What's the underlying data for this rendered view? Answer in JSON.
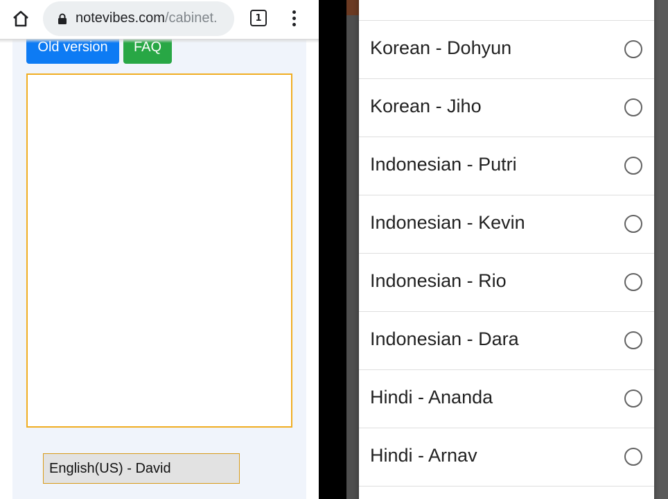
{
  "browser": {
    "url_domain": "notevibes.com",
    "url_path": "/cabinet.",
    "tab_count": "1",
    "icons": {
      "home": "home-icon",
      "lock": "lock-icon",
      "tabs": "tab-switcher-icon",
      "menu": "more-vert-icon"
    }
  },
  "page": {
    "old_version_label": "Old version",
    "faq_label": "FAQ",
    "textarea_value": "",
    "selected_voice": "English(US) - David",
    "colors": {
      "primary": "#0d7bf4",
      "success": "#28a745",
      "textarea_border": "#f0ad21"
    }
  },
  "voice_dialog": {
    "options": [
      {
        "label": "Korean - Dohyun",
        "selected": false
      },
      {
        "label": "Korean - Jiho",
        "selected": false
      },
      {
        "label": "Indonesian - Putri",
        "selected": false
      },
      {
        "label": "Indonesian - Kevin",
        "selected": false
      },
      {
        "label": "Indonesian - Rio",
        "selected": false
      },
      {
        "label": "Indonesian - Dara",
        "selected": false
      },
      {
        "label": "Hindi - Ananda",
        "selected": false
      },
      {
        "label": "Hindi - Arnav",
        "selected": false
      }
    ]
  }
}
